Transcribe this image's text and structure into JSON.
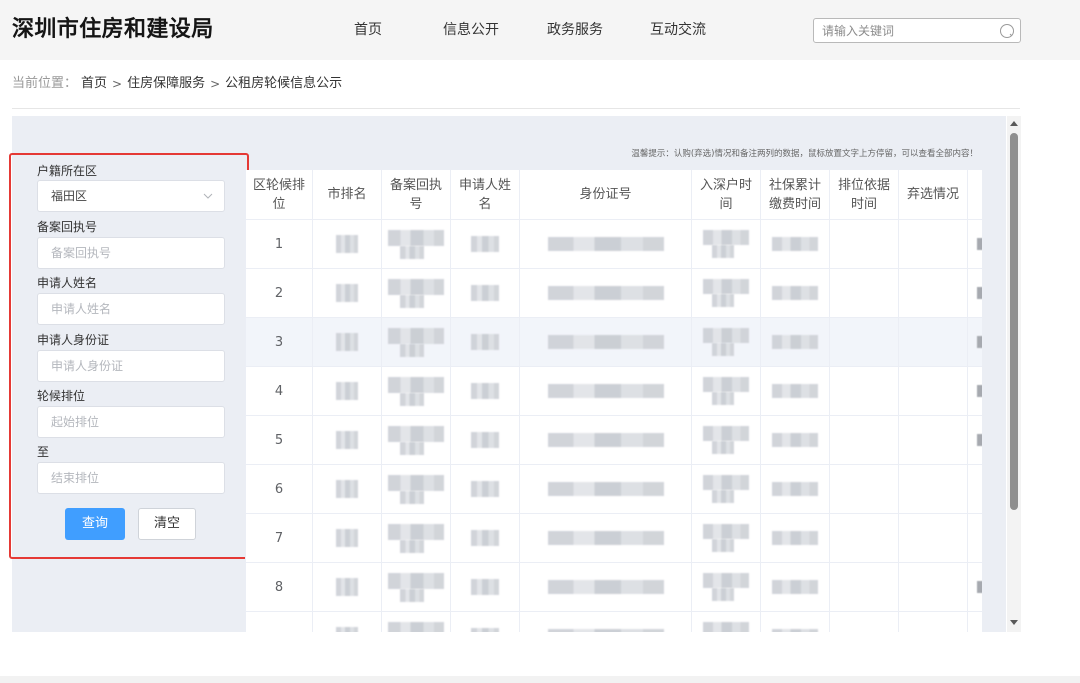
{
  "header": {
    "title": "深圳市住房和建设局",
    "nav": [
      {
        "label": "首页"
      },
      {
        "label": "信息公开"
      },
      {
        "label": "政务服务"
      },
      {
        "label": "互动交流"
      }
    ],
    "search": {
      "placeholder": "请输入关键词",
      "icon": "search-icon"
    }
  },
  "breadcrumb": {
    "prefix": "当前位置：",
    "separator": ">",
    "items": [
      "首页",
      "住房保障服务",
      "公租房轮候信息公示"
    ]
  },
  "filters": {
    "district": {
      "label": "户籍所在区",
      "value": "福田区",
      "icon": "chevron-down-icon"
    },
    "receipt_no": {
      "label": "备案回执号",
      "placeholder": "备案回执号"
    },
    "applicant_name": {
      "label": "申请人姓名",
      "placeholder": "申请人姓名"
    },
    "applicant_id": {
      "label": "申请人身份证",
      "placeholder": "申请人身份证"
    },
    "rank_from": {
      "label": "轮候排位",
      "placeholder": "起始排位"
    },
    "rank_to": {
      "label": "至",
      "placeholder": "结束排位"
    },
    "query_label": "查询",
    "clear_label": "清空"
  },
  "hint": "温馨提示：认购(弃选)情况和备注两列的数据，鼠标放置文字上方停留，可以查看全部内容！",
  "table": {
    "columns": [
      "区轮候排位",
      "市排名",
      "备案回执号",
      "申请人姓名",
      "身份证号",
      "入深户时间",
      "社保累计缴费时间",
      "排位依据时间",
      "弃选情况"
    ],
    "highlighted_row": 2,
    "rows": [
      {
        "rank": "1",
        "tail": true
      },
      {
        "rank": "2",
        "tail": true
      },
      {
        "rank": "3",
        "tail": true
      },
      {
        "rank": "4",
        "tail": true
      },
      {
        "rank": "5",
        "tail": true
      },
      {
        "rank": "6",
        "tail": false
      },
      {
        "rank": "7",
        "tail": false
      },
      {
        "rank": "8",
        "tail": true
      },
      {
        "tail": false
      }
    ]
  },
  "colors": {
    "primary": "#409eff",
    "annotation": "#e53935",
    "panel": "#ebeef4",
    "header_bg": "#f5f5f5"
  }
}
